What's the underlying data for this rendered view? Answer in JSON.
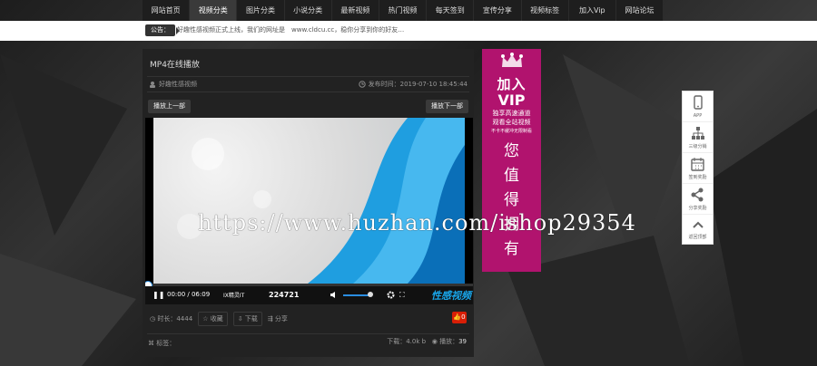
{
  "nav": {
    "items": [
      "网站首页",
      "视频分类",
      "图片分类",
      "小说分类",
      "最新视频",
      "热门视频",
      "每天签到",
      "宣传分享",
      "视频标签",
      "加入Vip",
      "网站论坛"
    ],
    "active_index": 1
  },
  "notice": {
    "label": "公告：",
    "text": "好趣性感视频正式上线，我们的网址是　www.cldcu.cc，稳你分享到你的好友…"
  },
  "video_page": {
    "title": "MP4在线播放",
    "author": "好趣性感视频",
    "publish_time": "发布时间：2019-07-10 18:45:44",
    "prev_button": "播放上一部",
    "next_button": "播放下一部"
  },
  "player": {
    "time": "00:00 / 06:09",
    "progress_fraction": 0.0,
    "clock_text": "224721",
    "extra_label": "IX精灵IT",
    "brand_mark": "性感视频",
    "volume_fraction": 0.8
  },
  "actions": {
    "duration": "时长：4444",
    "favorite": "收藏",
    "download": "下载",
    "share": "分享",
    "likes": "0"
  },
  "footer": {
    "tags_label": "标签：",
    "uploader_label": "下载：",
    "uploader_value": "4.0k b",
    "plays_label": "播放：",
    "plays_value": "39"
  },
  "vip": {
    "line1": "加入",
    "line2": "VIP",
    "sub1": "独享高速通道",
    "sub2": "观看全站视频",
    "sub3": "不卡不缓冲无限制看",
    "big": [
      "您",
      "值",
      "得",
      "拥",
      "有"
    ],
    "color": "#b1136e"
  },
  "side_tools": [
    {
      "icon": "phone-icon",
      "label": "APP"
    },
    {
      "icon": "sitemap-icon",
      "label": "三级分销"
    },
    {
      "icon": "calendar-icon",
      "label": "签到奖励"
    },
    {
      "icon": "share-icon",
      "label": "分享奖励"
    },
    {
      "icon": "chevron-up-icon",
      "label": "返回顶部"
    }
  ],
  "watermark": "https://www.huzhan.com/ishop29354",
  "colors": {
    "accent": "#2a8de0",
    "like": "#d81e06",
    "brand_blue": "#19a6ea"
  }
}
